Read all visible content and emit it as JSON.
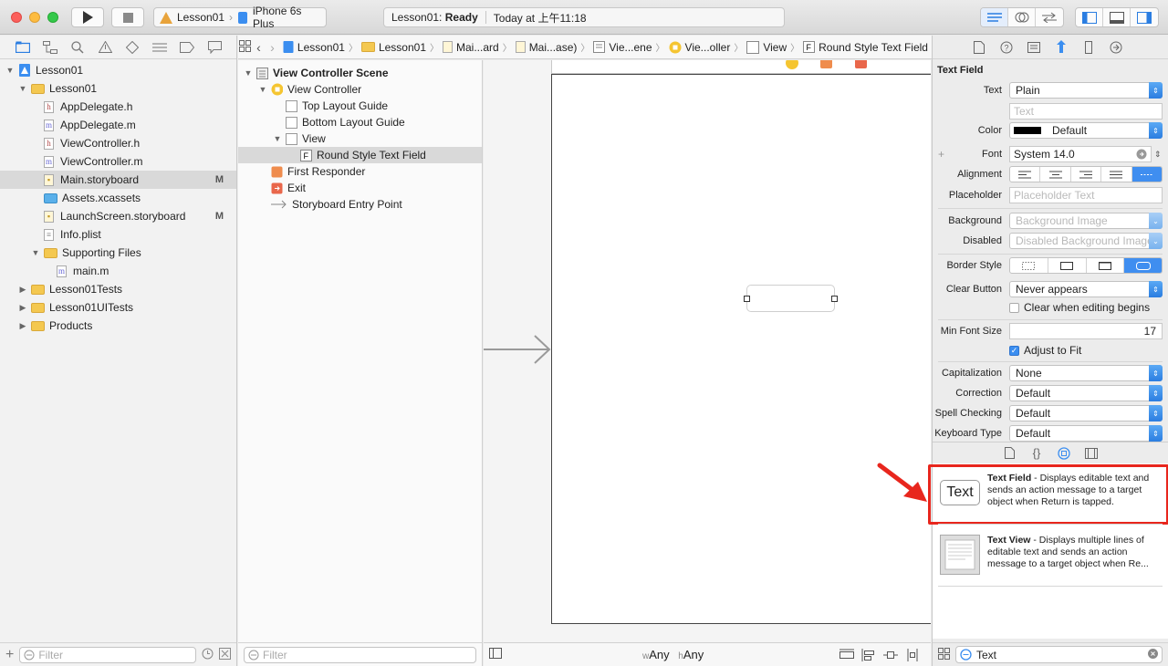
{
  "toolbar": {
    "scheme_project": "Lesson01",
    "scheme_device": "iPhone 6s Plus",
    "status_project": "Lesson01:",
    "status_state": "Ready",
    "status_time": "Today at 上午11:18"
  },
  "navigator": {
    "items": [
      {
        "label": "Lesson01",
        "depth": 0,
        "kind": "project",
        "disclosure": "▼"
      },
      {
        "label": "Lesson01",
        "depth": 1,
        "kind": "folder",
        "disclosure": "▼"
      },
      {
        "label": "AppDelegate.h",
        "depth": 2,
        "kind": "h"
      },
      {
        "label": "AppDelegate.m",
        "depth": 2,
        "kind": "m"
      },
      {
        "label": "ViewController.h",
        "depth": 2,
        "kind": "h"
      },
      {
        "label": "ViewController.m",
        "depth": 2,
        "kind": "m"
      },
      {
        "label": "Main.storyboard",
        "depth": 2,
        "kind": "storyboard",
        "mark": "M",
        "selected": true
      },
      {
        "label": "Assets.xcassets",
        "depth": 2,
        "kind": "assets"
      },
      {
        "label": "LaunchScreen.storyboard",
        "depth": 2,
        "kind": "storyboard",
        "mark": "M"
      },
      {
        "label": "Info.plist",
        "depth": 2,
        "kind": "plist"
      },
      {
        "label": "Supporting Files",
        "depth": 2,
        "kind": "folder",
        "disclosure": "▼"
      },
      {
        "label": "main.m",
        "depth": 3,
        "kind": "m"
      },
      {
        "label": "Lesson01Tests",
        "depth": 1,
        "kind": "folder",
        "disclosure": "▶"
      },
      {
        "label": "Lesson01UITests",
        "depth": 1,
        "kind": "folder",
        "disclosure": "▶"
      },
      {
        "label": "Products",
        "depth": 1,
        "kind": "folder",
        "disclosure": "▶"
      }
    ],
    "filter_placeholder": "Filter"
  },
  "jumpbar": {
    "crumbs": [
      "Lesson01",
      "Lesson01",
      "Mai...ard",
      "Mai...ase)",
      "Vie...ene",
      "Vie...oller",
      "View",
      "Round Style Text Field"
    ]
  },
  "outline": {
    "items": [
      {
        "label": "View Controller Scene",
        "depth": 0,
        "bold": true,
        "disclosure": "▼"
      },
      {
        "label": "View Controller",
        "depth": 1,
        "disclosure": "▼"
      },
      {
        "label": "Top Layout Guide",
        "depth": 2
      },
      {
        "label": "Bottom Layout Guide",
        "depth": 2
      },
      {
        "label": "View",
        "depth": 2,
        "disclosure": "▼"
      },
      {
        "label": "Round Style Text Field",
        "depth": 3,
        "selected": true
      },
      {
        "label": "First Responder",
        "depth": 1
      },
      {
        "label": "Exit",
        "depth": 1
      },
      {
        "label": "Storyboard Entry Point",
        "depth": 1
      }
    ],
    "filter_placeholder": "Filter"
  },
  "canvas": {
    "size_class_w": "Any",
    "size_class_h": "Any",
    "w_prefix": "w",
    "h_prefix": "h"
  },
  "inspector": {
    "section_title": "Text Field",
    "text_label": "Text",
    "text_value": "Plain",
    "text_placeholder": "Text",
    "color_label": "Color",
    "color_value": "Default",
    "font_label": "Font",
    "font_value": "System 14.0",
    "alignment_label": "Alignment",
    "placeholder_label": "Placeholder",
    "placeholder_placeholder": "Placeholder Text",
    "background_label": "Background",
    "background_value": "Background Image",
    "disabled_label": "Disabled",
    "disabled_value": "Disabled Background Image",
    "border_style_label": "Border Style",
    "clear_button_label": "Clear Button",
    "clear_button_value": "Never appears",
    "clear_editing_label": "Clear when editing begins",
    "min_font_label": "Min Font Size",
    "min_font_value": "17",
    "adjust_label": "Adjust to Fit",
    "capitalization_label": "Capitalization",
    "capitalization_value": "None",
    "correction_label": "Correction",
    "correction_value": "Default",
    "spell_label": "Spell Checking",
    "spell_value": "Default",
    "keyboard_label": "Keyboard Type",
    "keyboard_value": "Default"
  },
  "library": {
    "items": [
      {
        "thumb": "Text",
        "title": "Text Field",
        "desc": " - Displays editable text and sends an action message to a target object when Return is tapped."
      },
      {
        "title": "Text View",
        "desc": " - Displays multiple lines of editable text and sends an action message to a target object when Re..."
      }
    ],
    "search_value": "Text"
  },
  "colors": {
    "accent": "#3b8ef0",
    "annotation": "#e8261d"
  }
}
